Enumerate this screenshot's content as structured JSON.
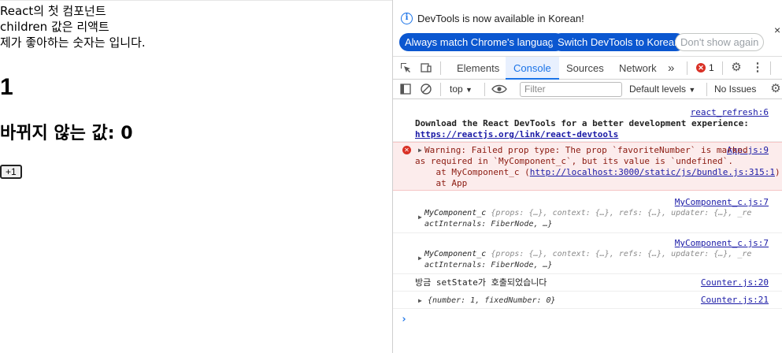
{
  "app": {
    "line1": "React의 첫 컴포넌트",
    "line2": "children 값은 리액트",
    "line3": "제가 좋아하는 숫자는 입니다.",
    "number": "1",
    "fixed_heading": "바뀌지 않는 값: 0",
    "plus_button": "+1"
  },
  "infobar": {
    "message": "DevTools is now available in Korean!",
    "btn_match": "Always match Chrome's language",
    "btn_switch": "Switch DevTools to Korean",
    "btn_dismiss": "Don't show again",
    "close": "×"
  },
  "tabs": {
    "elements": "Elements",
    "console": "Console",
    "sources": "Sources",
    "network": "Network",
    "more": "»",
    "error_count": "1"
  },
  "filterbar": {
    "context": "top",
    "filter_placeholder": "Filter",
    "levels": "Default levels",
    "issues": "No Issues"
  },
  "console": {
    "m1": {
      "source": "react_refresh:6",
      "line1": "Download the React DevTools for a better development experience:",
      "link": "https://reactjs.org/link/react-devtools"
    },
    "m2": {
      "source": "App.js:9",
      "line1": "Warning: Failed prop type: The prop `favoriteNumber` is marked",
      "line2": "as required in `MyComponent_c`, but its value is `undefined`.",
      "line3_prefix": "    at MyComponent_c (",
      "line3_link": "http://localhost:3000/static/js/bundle.js:315:1",
      "line3_suffix": ")",
      "line4": "    at App"
    },
    "m3": {
      "source": "MyComponent_c.js:7",
      "name": "MyComponent_c",
      "props": "{props: {…}, context: {…}, refs: {…}, updater: {…}, _re",
      "cont": "actInternals: FiberNode, …}"
    },
    "m4": {
      "source": "MyComponent_c.js:7",
      "name": "MyComponent_c",
      "props": "{props: {…}, context: {…}, refs: {…}, updater: {…}, _re",
      "cont": "actInternals: FiberNode, …}"
    },
    "m5": {
      "source": "Counter.js:20",
      "text": "방금 setState가 호출되었습니다"
    },
    "m6": {
      "source": "Counter.js:21",
      "text": "{number: 1, fixedNumber: 0}"
    },
    "prompt": "›"
  }
}
